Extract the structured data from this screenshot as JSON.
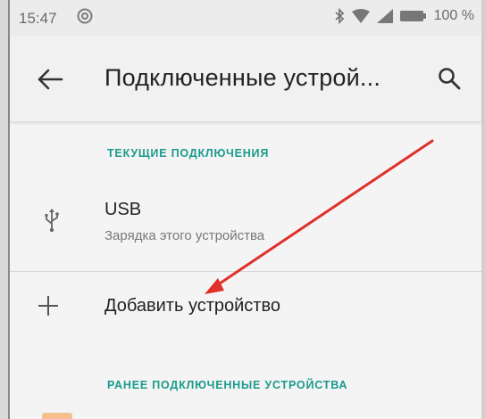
{
  "status_bar": {
    "time": "15:47",
    "battery_percent": "100 %",
    "icons": [
      "sync-icon",
      "bluetooth-icon",
      "wifi-icon",
      "signal-icon",
      "battery-icon"
    ]
  },
  "app_bar": {
    "title": "Подключенные устрой...",
    "back_icon": "back-arrow-icon",
    "search_icon": "search-icon"
  },
  "sections": {
    "current_header": "ТЕКУЩИЕ ПОДКЛЮЧЕНИЯ",
    "previous_header": "РАНЕЕ ПОДКЛЮЧЕННЫЕ УСТРОЙСТВА"
  },
  "usb_item": {
    "title": "USB",
    "subtitle": "Зарядка этого устройства",
    "icon": "usb-icon"
  },
  "add_device": {
    "label": "Добавить устройство",
    "icon": "plus-icon"
  },
  "colors": {
    "accent_teal": "#1a9a8c",
    "annotation_arrow": "#e0302a"
  }
}
